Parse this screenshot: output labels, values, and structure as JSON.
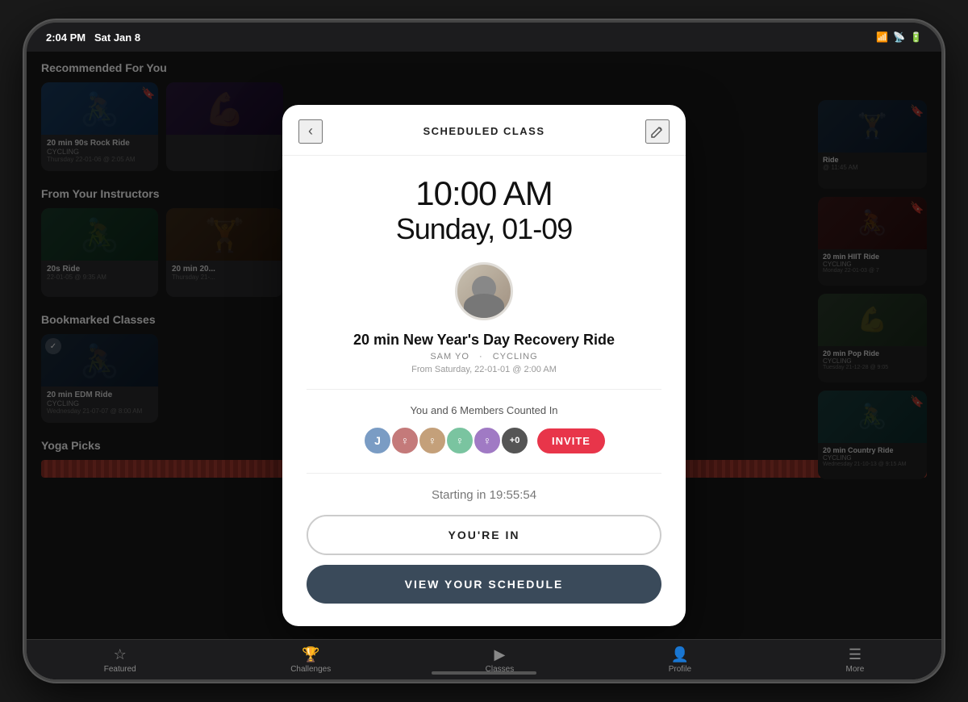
{
  "status_bar": {
    "time": "2:04 PM",
    "date": "Sat Jan 8"
  },
  "modal": {
    "title": "SCHEDULED CLASS",
    "time": "10:00 AM",
    "date": "Sunday, 01-09",
    "class_name": "20 min New Year's Day Recovery Ride",
    "instructor": "SAM YO",
    "category": "CYCLING",
    "from_date": "From Saturday, 22-01-01 @ 2:00 AM",
    "members_label": "You and 6 Members Counted In",
    "invite_label": "INVITE",
    "timer_label": "Starting in 19:55:54",
    "youre_in_label": "YOU'RE IN",
    "schedule_label": "VIEW YOUR SCHEDULE",
    "members": [
      {
        "initial": "J",
        "color": "#7a9cc4"
      },
      {
        "initial": "♀",
        "color": "#c47a7a"
      },
      {
        "initial": "♀",
        "color": "#c4a07a"
      },
      {
        "initial": "♀",
        "color": "#7ac4a0"
      },
      {
        "initial": "♀",
        "color": "#a07ac4"
      },
      {
        "initial": "+0",
        "color": "#555"
      }
    ]
  },
  "background": {
    "recommended_title": "Recommended For You",
    "instructors_title": "From Your Instructors",
    "bookmarked_title": "Bookmarked Classes",
    "yoga_title": "Yoga Picks",
    "cards": [
      {
        "title": "20 min 90s Rock Ride",
        "category": "CYCLING",
        "date": "Thursday 22-01-06 @ 2:05 AM"
      },
      {
        "title": "20 min HIIT Ride",
        "category": "CYCLING",
        "date": "Monday 22-01-03 @ 7"
      },
      {
        "title": "20 min EDM Ride",
        "category": "CYCLING",
        "date": "Wednesday 21-07-07 @ 8:00 AM"
      },
      {
        "title": "20 min Country Ride",
        "category": "CYCLING",
        "date": "Wednesday 21-10-13 @ 9:15 AM"
      }
    ]
  },
  "nav": {
    "items": [
      {
        "label": "Featured",
        "icon": "☆"
      },
      {
        "label": "Challenges",
        "icon": "🏆"
      },
      {
        "label": "Classes",
        "icon": "▶"
      },
      {
        "label": "Profile",
        "icon": "👤"
      },
      {
        "label": "More",
        "icon": "☰"
      }
    ]
  }
}
